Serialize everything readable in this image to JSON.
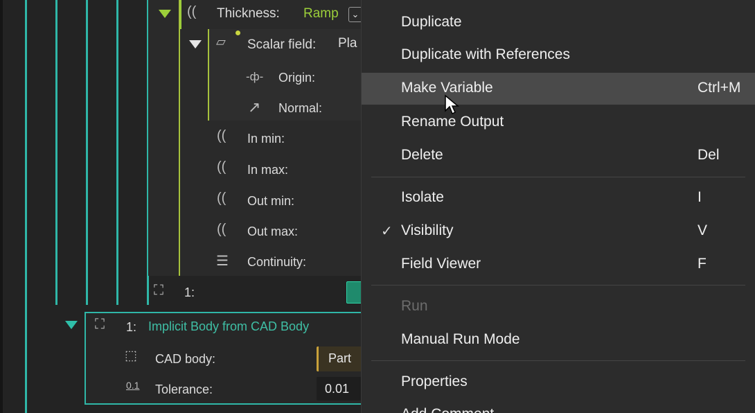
{
  "tree": {
    "thickness": {
      "label": "Thickness:",
      "value": "Ramp"
    },
    "scalar_field": {
      "label": "Scalar field:",
      "value": "Pla"
    },
    "origin": {
      "label": "Origin:"
    },
    "normal": {
      "label": "Normal:"
    },
    "in_min": {
      "label": "In min:"
    },
    "in_max": {
      "label": "In max:"
    },
    "out_min": {
      "label": "Out min:"
    },
    "out_max": {
      "label": "Out max:"
    },
    "continuity": {
      "label": "Continuity:"
    },
    "ref_row": {
      "index": "1:"
    },
    "implicit_body": {
      "index": "1:",
      "title": "Implicit Body from CAD Body"
    },
    "cad_body": {
      "label": "CAD body:",
      "value": "Part"
    },
    "tolerance": {
      "label": "Tolerance:",
      "value": "0.01",
      "icon_text": "0.1"
    }
  },
  "menu": {
    "items": [
      {
        "label": "Duplicate",
        "shortcut": ""
      },
      {
        "label": "Duplicate with References",
        "shortcut": ""
      },
      {
        "label": "Make Variable",
        "shortcut": "Ctrl+M",
        "hover": true
      },
      {
        "label": "Rename Output",
        "shortcut": ""
      },
      {
        "label": "Delete",
        "shortcut": "Del"
      },
      {
        "label": "Isolate",
        "shortcut": "I"
      },
      {
        "label": "Visibility",
        "shortcut": "V",
        "checked": true,
        "check": "✓"
      },
      {
        "label": "Field Viewer",
        "shortcut": "F"
      },
      {
        "label": "Run",
        "shortcut": "",
        "disabled": true
      },
      {
        "label": "Manual Run Mode",
        "shortcut": ""
      },
      {
        "label": "Properties",
        "shortcut": ""
      },
      {
        "label": "Add Comment",
        "shortcut": ""
      }
    ]
  },
  "colors": {
    "accent_teal": "#2fb7a8",
    "accent_green": "#9ccf3a",
    "menu_bg": "#2c2c2c",
    "hover_bg": "#4a4a4a"
  },
  "icons": [
    "ramp-icon",
    "plane-icon",
    "origin-icon",
    "vector-icon",
    "list-icon",
    "cad-body-icon",
    "cursor-icon"
  ]
}
